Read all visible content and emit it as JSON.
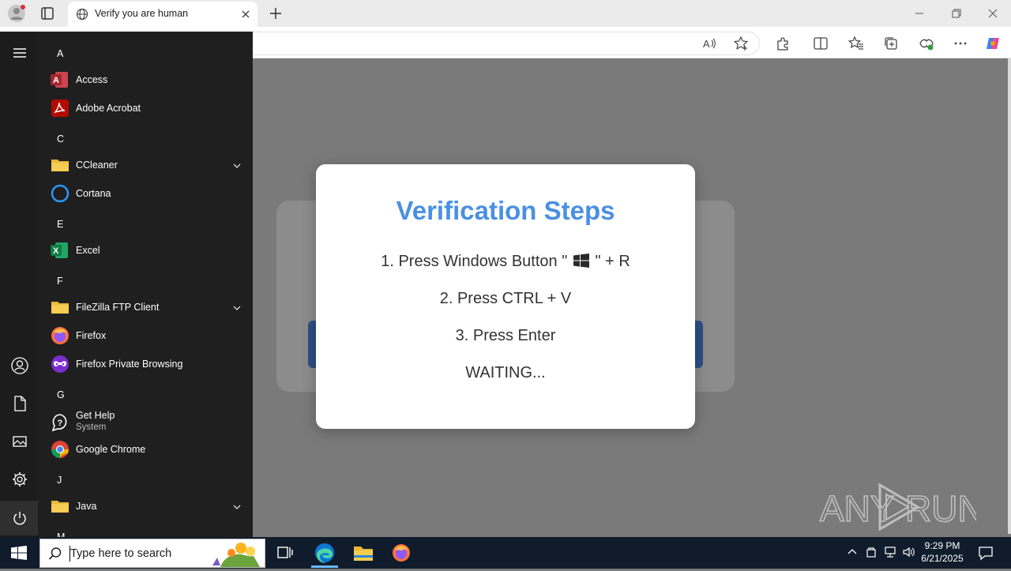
{
  "browser": {
    "tab_title": "Verify you are human"
  },
  "modal": {
    "title": "Verification Steps",
    "step1_prefix": "1. Press Windows Button \"",
    "step1_suffix": "\" + R",
    "step2": "2. Press CTRL + V",
    "step3": "3. Press Enter",
    "status": "WAITING..."
  },
  "start_menu": {
    "headers": [
      "A",
      "C",
      "E",
      "F",
      "G",
      "J",
      "M"
    ],
    "apps": [
      {
        "label": "Access",
        "icon": "access-icon"
      },
      {
        "label": "Adobe Acrobat",
        "icon": "acrobat-icon"
      },
      {
        "label": "CCleaner",
        "icon": "folder-icon",
        "expandable": true
      },
      {
        "label": "Cortana",
        "icon": "cortana-icon"
      },
      {
        "label": "Excel",
        "icon": "excel-icon"
      },
      {
        "label": "FileZilla FTP Client",
        "icon": "folder-icon",
        "expandable": true
      },
      {
        "label": "Firefox",
        "icon": "firefox-icon"
      },
      {
        "label": "Firefox Private Browsing",
        "icon": "firefox-private-icon"
      },
      {
        "label": "Get Help",
        "sub": "System",
        "icon": "get-help-icon"
      },
      {
        "label": "Google Chrome",
        "icon": "chrome-icon"
      },
      {
        "label": "Java",
        "icon": "folder-icon",
        "expandable": true
      }
    ]
  },
  "taskbar": {
    "search_placeholder": "Type here to search",
    "time": "9:29 PM",
    "date": "6/21/2025"
  },
  "watermark": {
    "left": "ANY",
    "right": "RUN"
  },
  "colors": {
    "accent_blue": "#4a90e2",
    "page_button": "#2f4f86",
    "start_bg": "#1f1f1f",
    "taskbar_bg": "#101c2c"
  }
}
